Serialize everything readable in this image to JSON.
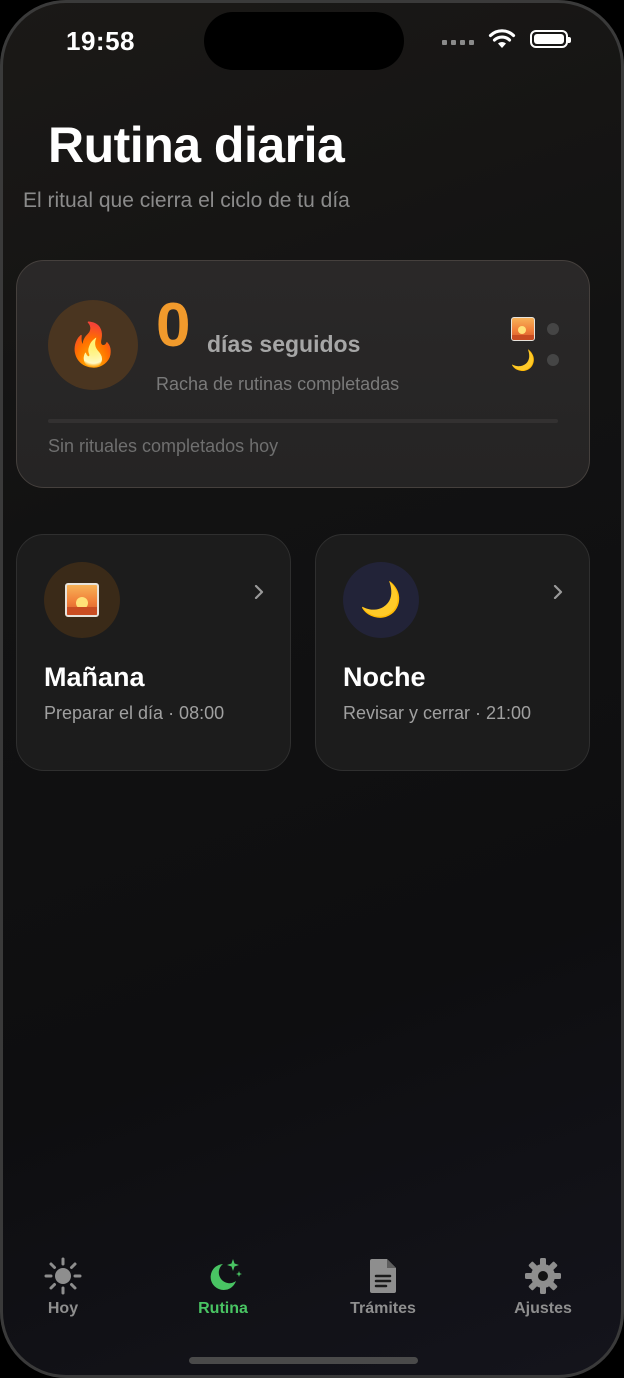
{
  "status_bar": {
    "time": "19:58"
  },
  "header": {
    "title": "Rutina diaria",
    "subtitle": "El ritual que cierra el ciclo de tu día"
  },
  "streak": {
    "count": "0",
    "unit": "días seguidos",
    "description": "Racha de rutinas completadas",
    "status": "Sin rituales completados hoy",
    "progress": 0,
    "accent_color": "#f19a2c",
    "icon": "fire-icon",
    "mini_items": [
      {
        "icon": "sunrise-icon",
        "done": false
      },
      {
        "icon": "crescent-moon-icon",
        "done": false
      }
    ]
  },
  "routines": [
    {
      "name": "Mañana",
      "detail": "Preparar el día · 08:00",
      "icon": "sunrise-icon"
    },
    {
      "name": "Noche",
      "detail": "Revisar y cerrar · 21:00",
      "icon": "crescent-moon-icon"
    }
  ],
  "tab_bar": {
    "active_color": "#49c463",
    "tabs": [
      {
        "label": "Hoy",
        "icon": "sun-icon",
        "active": false
      },
      {
        "label": "Rutina",
        "icon": "moon-stars-icon",
        "active": true
      },
      {
        "label": "Trámites",
        "icon": "document-icon",
        "active": false
      },
      {
        "label": "Ajustes",
        "icon": "gear-icon",
        "active": false
      }
    ]
  }
}
